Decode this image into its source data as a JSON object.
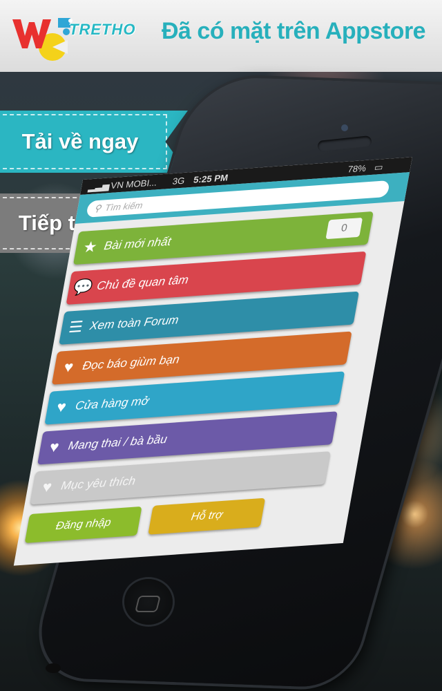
{
  "header": {
    "logo_text": "TRETHO",
    "tagline": "Đã có mặt trên Appstore"
  },
  "ribbons": {
    "download": "Tải về ngay",
    "continue": "Tiếp tục"
  },
  "phone": {
    "status": {
      "carrier": "VN MOBI...",
      "network": "3G",
      "time": "5:25 PM",
      "battery": "78%"
    },
    "search_placeholder": "Tìm kiếm",
    "menu": [
      {
        "label": "Bài mới nhất",
        "icon": "star-icon",
        "color": "#7db33a",
        "count": "0"
      },
      {
        "label": "Chủ đề quan tâm",
        "icon": "chat-bubble-icon",
        "color": "#d9454d"
      },
      {
        "label": "Xem toàn Forum",
        "icon": "list-icon",
        "color": "#2e8ea8"
      },
      {
        "label": "Đọc báo giùm bạn",
        "icon": "heart-icon",
        "color": "#d46b2a"
      },
      {
        "label": "Cửa hàng mở",
        "icon": "heart-icon",
        "color": "#2fa5c8"
      },
      {
        "label": "Mang thai / bà bầu",
        "icon": "heart-icon",
        "color": "#6c5aa8"
      },
      {
        "label": "Mục yêu thích",
        "icon": "heart-icon",
        "color": "#c9c9c9"
      }
    ],
    "buttons": {
      "login": "Đăng nhập",
      "support": "Hỗ trợ"
    }
  }
}
